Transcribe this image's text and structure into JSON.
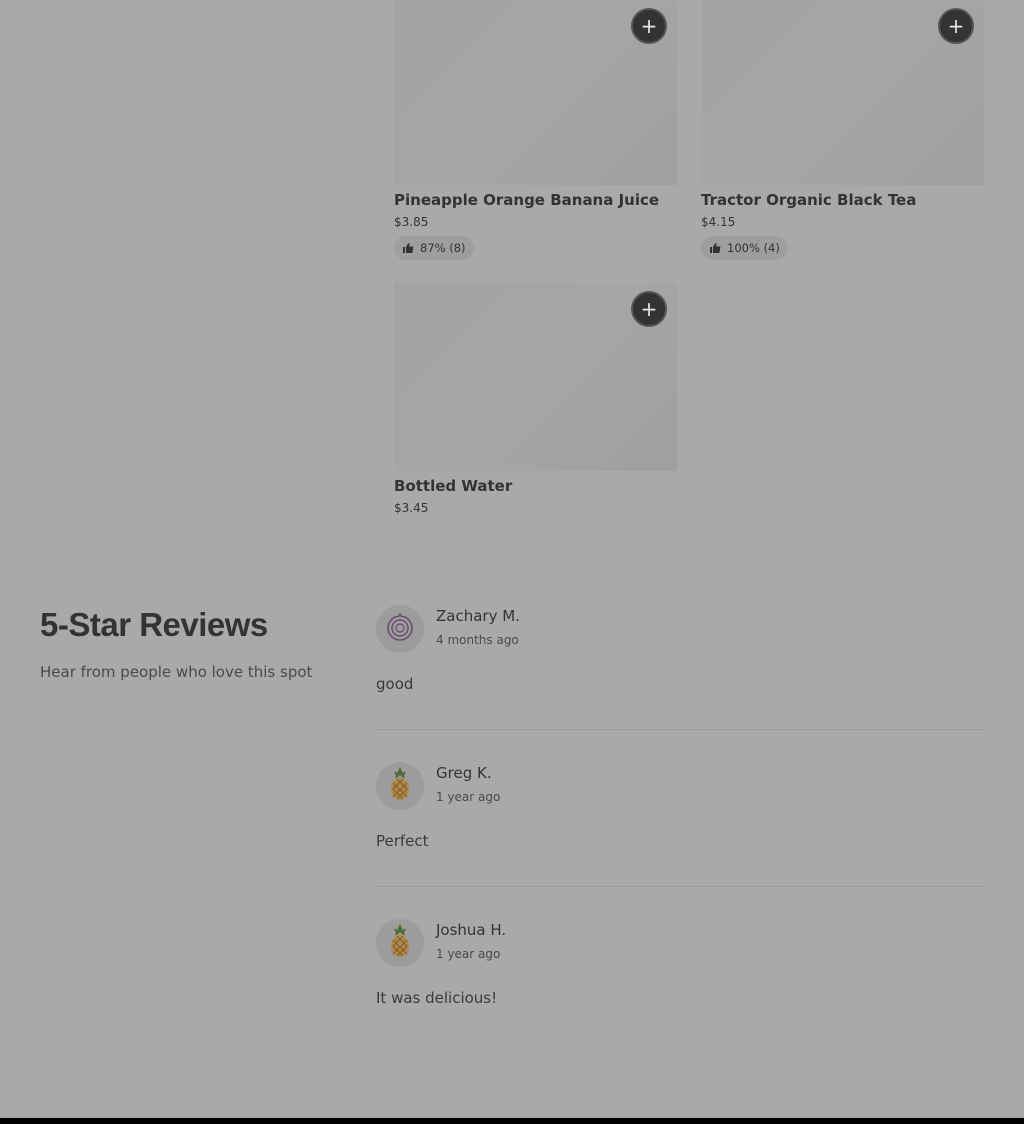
{
  "products": [
    {
      "name": "Pineapple Orange Banana Juice",
      "price": "$3.85",
      "rating": "87% (8)"
    },
    {
      "name": "Tractor Organic Black Tea",
      "price": "$4.15",
      "rating": "100% (4)"
    },
    {
      "name": "Bottled Water",
      "price": "$3.45",
      "rating": null
    }
  ],
  "add_button_label": "+",
  "reviews_section": {
    "title": "5-Star Reviews",
    "subtitle": "Hear from people who love this spot",
    "reviews": [
      {
        "name": "Zachary M.",
        "date": "4 months ago",
        "text": "good",
        "avatar": "onion-icon"
      },
      {
        "name": "Greg K.",
        "date": "1 year ago",
        "text": "Perfect",
        "avatar": "pineapple-icon"
      },
      {
        "name": "Joshua H.",
        "date": "1 year ago",
        "text": "It was delicious!",
        "avatar": "pineapple-icon"
      }
    ]
  },
  "colors": {
    "overlay_background": "#a9a9a9",
    "add_button": "#333333",
    "text_primary": "#333333"
  }
}
